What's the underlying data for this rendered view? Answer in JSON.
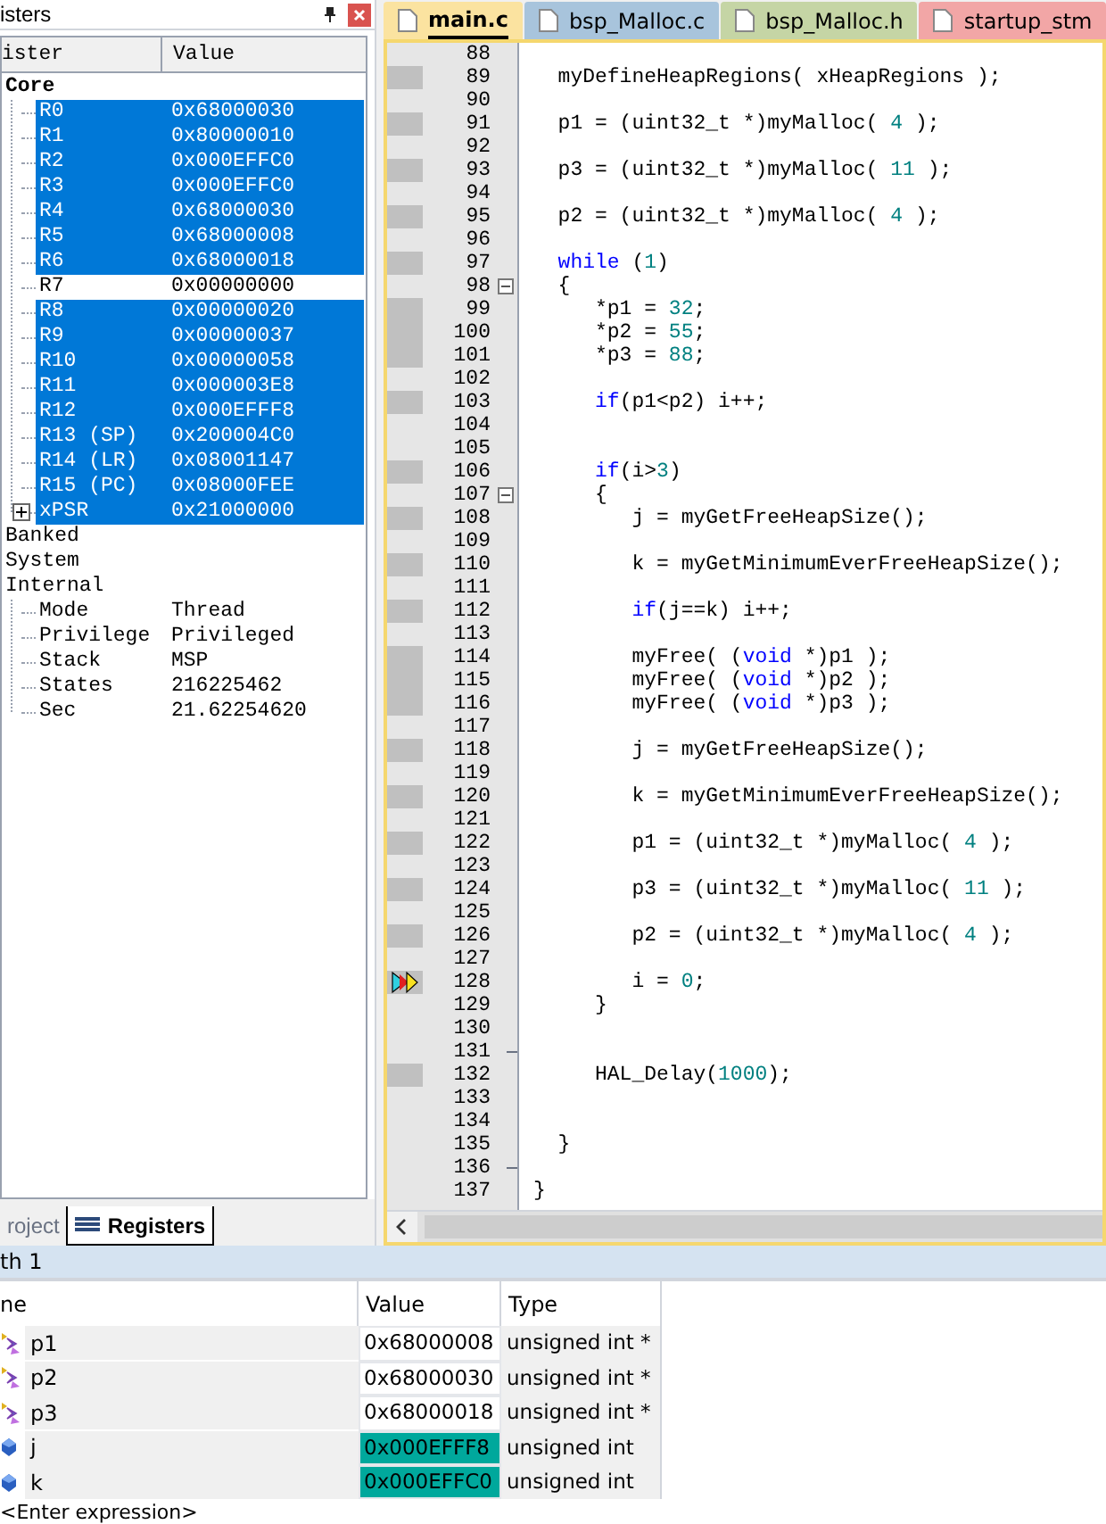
{
  "registers_panel": {
    "title": "isters",
    "columns": [
      "ister",
      "Value"
    ],
    "tree": [
      {
        "name": "Core",
        "children": [
          {
            "name": "R0",
            "value": "0x68000030",
            "selected": true,
            "kind": "register"
          },
          {
            "name": "R1",
            "value": "0x80000010",
            "selected": true,
            "kind": "register"
          },
          {
            "name": "R2",
            "value": "0x000EFFC0",
            "selected": true,
            "kind": "register"
          },
          {
            "name": "R3",
            "value": "0x000EFFC0",
            "selected": true,
            "kind": "register"
          },
          {
            "name": "R4",
            "value": "0x68000030",
            "selected": true,
            "kind": "register"
          },
          {
            "name": "R5",
            "value": "0x68000008",
            "selected": true,
            "kind": "register"
          },
          {
            "name": "R6",
            "value": "0x68000018",
            "selected": true,
            "kind": "register"
          },
          {
            "name": "R7",
            "value": "0x00000000",
            "selected": false,
            "kind": "register"
          },
          {
            "name": "R8",
            "value": "0x00000020",
            "selected": true,
            "kind": "register"
          },
          {
            "name": "R9",
            "value": "0x00000037",
            "selected": true,
            "kind": "register"
          },
          {
            "name": "R10",
            "value": "0x00000058",
            "selected": true,
            "kind": "register"
          },
          {
            "name": "R11",
            "value": "0x000003E8",
            "selected": true,
            "kind": "register"
          },
          {
            "name": "R12",
            "value": "0x000EFFF8",
            "selected": true,
            "kind": "register"
          },
          {
            "name": "R13 (SP)",
            "value": "0x200004C0",
            "selected": true,
            "kind": "register"
          },
          {
            "name": "R14 (LR)",
            "value": "0x08001147",
            "selected": true,
            "kind": "register"
          },
          {
            "name": "R15 (PC)",
            "value": "0x08000FEE",
            "selected": true,
            "kind": "register"
          },
          {
            "name": "xPSR",
            "value": "0x21000000",
            "selected": true,
            "kind": "group"
          }
        ]
      },
      {
        "name": "Banked"
      },
      {
        "name": "System"
      },
      {
        "name": "Internal",
        "children": [
          {
            "name": "Mode",
            "value": "Thread",
            "selected": false,
            "kind": "register"
          },
          {
            "name": "Privilege",
            "value": "Privileged",
            "selected": false,
            "kind": "register"
          },
          {
            "name": "Stack",
            "value": "MSP",
            "selected": false,
            "kind": "register"
          },
          {
            "name": "States",
            "value": "216225462",
            "selected": false,
            "kind": "register"
          },
          {
            "name": "Sec",
            "value": "21.62254620",
            "selected": false,
            "kind": "register"
          }
        ]
      }
    ],
    "bottom_tabs": [
      {
        "label": "roject",
        "selected": false
      },
      {
        "label": "Registers",
        "selected": true
      }
    ]
  },
  "editor": {
    "tabs": [
      {
        "label": "main.c",
        "selected": true,
        "color": "#fbe3a0"
      },
      {
        "label": "bsp_Malloc.c",
        "selected": false,
        "color": "#a8c4dc"
      },
      {
        "label": "bsp_Malloc.h",
        "selected": false,
        "color": "#c5d5a5"
      },
      {
        "label": "startup_stm",
        "selected": false,
        "color": "#f2a6a6"
      }
    ],
    "lines": [
      {
        "number": "88",
        "kind": "plain",
        "executable": false,
        "current": false
      },
      {
        "number": "89",
        "kind": "plain",
        "executable": true,
        "current": false,
        "code": [
          {
            "kind": "plain",
            "text": "  myDefineHeapRegions( xHeapRegions );"
          }
        ]
      },
      {
        "number": "90",
        "kind": "plain",
        "executable": false,
        "current": false
      },
      {
        "number": "91",
        "kind": "plain",
        "executable": true,
        "current": false,
        "code": [
          {
            "kind": "plain",
            "text": "  p1 = (uint32_t *)myMalloc( "
          },
          {
            "kind": "number",
            "text": "4"
          },
          {
            "kind": "plain",
            "text": " );"
          }
        ]
      },
      {
        "number": "92",
        "kind": "plain",
        "executable": false,
        "current": false
      },
      {
        "number": "93",
        "kind": "plain",
        "executable": true,
        "current": false,
        "code": [
          {
            "kind": "plain",
            "text": "  p3 = (uint32_t *)myMalloc( "
          },
          {
            "kind": "number",
            "text": "11"
          },
          {
            "kind": "plain",
            "text": " );"
          }
        ]
      },
      {
        "number": "94",
        "kind": "plain",
        "executable": false,
        "current": false
      },
      {
        "number": "95",
        "kind": "plain",
        "executable": true,
        "current": false,
        "code": [
          {
            "kind": "plain",
            "text": "  p2 = (uint32_t *)myMalloc( "
          },
          {
            "kind": "number",
            "text": "4"
          },
          {
            "kind": "plain",
            "text": " );"
          }
        ]
      },
      {
        "number": "96",
        "kind": "plain",
        "executable": false,
        "current": false
      },
      {
        "number": "97",
        "kind": "plain",
        "executable": true,
        "current": false,
        "code": [
          {
            "kind": "keyword",
            "text": "  while"
          },
          {
            "kind": "plain",
            "text": " ("
          },
          {
            "kind": "number",
            "text": "1"
          },
          {
            "kind": "plain",
            "text": ")"
          }
        ]
      },
      {
        "number": "98",
        "kind": "fold_start",
        "executable": false,
        "current": false,
        "code": [
          {
            "kind": "plain",
            "text": "  {"
          }
        ]
      },
      {
        "number": "99",
        "kind": "plain",
        "executable": true,
        "current": false,
        "code": [
          {
            "kind": "plain",
            "text": "     *p1 = "
          },
          {
            "kind": "number",
            "text": "32"
          },
          {
            "kind": "plain",
            "text": ";"
          }
        ]
      },
      {
        "number": "100",
        "kind": "plain",
        "executable": true,
        "current": false,
        "code": [
          {
            "kind": "plain",
            "text": "     *p2 = "
          },
          {
            "kind": "number",
            "text": "55"
          },
          {
            "kind": "plain",
            "text": ";"
          }
        ]
      },
      {
        "number": "101",
        "kind": "plain",
        "executable": true,
        "current": false,
        "code": [
          {
            "kind": "plain",
            "text": "     *p3 = "
          },
          {
            "kind": "number",
            "text": "88"
          },
          {
            "kind": "plain",
            "text": ";"
          }
        ]
      },
      {
        "number": "102",
        "kind": "plain",
        "executable": false,
        "current": false
      },
      {
        "number": "103",
        "kind": "plain",
        "executable": true,
        "current": false,
        "code": [
          {
            "kind": "keyword",
            "text": "     if"
          },
          {
            "kind": "plain",
            "text": "(p1<p2) i++;"
          }
        ]
      },
      {
        "number": "104",
        "kind": "plain",
        "executable": false,
        "current": false
      },
      {
        "number": "105",
        "kind": "plain",
        "executable": false,
        "current": false
      },
      {
        "number": "106",
        "kind": "plain",
        "executable": true,
        "current": false,
        "code": [
          {
            "kind": "keyword",
            "text": "     if"
          },
          {
            "kind": "plain",
            "text": "(i>"
          },
          {
            "kind": "number",
            "text": "3"
          },
          {
            "kind": "plain",
            "text": ")"
          }
        ]
      },
      {
        "number": "107",
        "kind": "fold_start",
        "executable": false,
        "current": false,
        "code": [
          {
            "kind": "plain",
            "text": "     {"
          }
        ]
      },
      {
        "number": "108",
        "kind": "plain",
        "executable": true,
        "current": false,
        "code": [
          {
            "kind": "plain",
            "text": "        j = myGetFreeHeapSize();"
          }
        ]
      },
      {
        "number": "109",
        "kind": "plain",
        "executable": false,
        "current": false
      },
      {
        "number": "110",
        "kind": "plain",
        "executable": true,
        "current": false,
        "code": [
          {
            "kind": "plain",
            "text": "        k = myGetMinimumEverFreeHeapSize();"
          }
        ]
      },
      {
        "number": "111",
        "kind": "plain",
        "executable": false,
        "current": false
      },
      {
        "number": "112",
        "kind": "plain",
        "executable": true,
        "current": false,
        "code": [
          {
            "kind": "keyword",
            "text": "        if"
          },
          {
            "kind": "plain",
            "text": "(j==k) i++;"
          }
        ]
      },
      {
        "number": "113",
        "kind": "plain",
        "executable": false,
        "current": false
      },
      {
        "number": "114",
        "kind": "plain",
        "executable": true,
        "current": false,
        "code": [
          {
            "kind": "plain",
            "text": "        myFree( ("
          },
          {
            "kind": "keyword",
            "text": "void"
          },
          {
            "kind": "plain",
            "text": " *)p1 );"
          }
        ]
      },
      {
        "number": "115",
        "kind": "plain",
        "executable": true,
        "current": false,
        "code": [
          {
            "kind": "plain",
            "text": "        myFree( ("
          },
          {
            "kind": "keyword",
            "text": "void"
          },
          {
            "kind": "plain",
            "text": " *)p2 );"
          }
        ]
      },
      {
        "number": "116",
        "kind": "plain",
        "executable": true,
        "current": false,
        "code": [
          {
            "kind": "plain",
            "text": "        myFree( ("
          },
          {
            "kind": "keyword",
            "text": "void"
          },
          {
            "kind": "plain",
            "text": " *)p3 );"
          }
        ]
      },
      {
        "number": "117",
        "kind": "plain",
        "executable": false,
        "current": false
      },
      {
        "number": "118",
        "kind": "plain",
        "executable": true,
        "current": false,
        "code": [
          {
            "kind": "plain",
            "text": "        j = myGetFreeHeapSize();"
          }
        ]
      },
      {
        "number": "119",
        "kind": "plain",
        "executable": false,
        "current": false
      },
      {
        "number": "120",
        "kind": "plain",
        "executable": true,
        "current": false,
        "code": [
          {
            "kind": "plain",
            "text": "        k = myGetMinimumEverFreeHeapSize();"
          }
        ]
      },
      {
        "number": "121",
        "kind": "plain",
        "executable": false,
        "current": false
      },
      {
        "number": "122",
        "kind": "plain",
        "executable": true,
        "current": false,
        "code": [
          {
            "kind": "plain",
            "text": "        p1 = (uint32_t *)myMalloc( "
          },
          {
            "kind": "number",
            "text": "4"
          },
          {
            "kind": "plain",
            "text": " );"
          }
        ]
      },
      {
        "number": "123",
        "kind": "plain",
        "executable": false,
        "current": false
      },
      {
        "number": "124",
        "kind": "plain",
        "executable": true,
        "current": false,
        "code": [
          {
            "kind": "plain",
            "text": "        p3 = (uint32_t *)myMalloc( "
          },
          {
            "kind": "number",
            "text": "11"
          },
          {
            "kind": "plain",
            "text": " );"
          }
        ]
      },
      {
        "number": "125",
        "kind": "plain",
        "executable": false,
        "current": false
      },
      {
        "number": "126",
        "kind": "plain",
        "executable": true,
        "current": false,
        "code": [
          {
            "kind": "plain",
            "text": "        p2 = (uint32_t *)myMalloc( "
          },
          {
            "kind": "number",
            "text": "4"
          },
          {
            "kind": "plain",
            "text": " );"
          }
        ]
      },
      {
        "number": "127",
        "kind": "plain",
        "executable": false,
        "current": false
      },
      {
        "number": "128",
        "kind": "plain",
        "executable": true,
        "current": true,
        "code": [
          {
            "kind": "plain",
            "text": "        i = "
          },
          {
            "kind": "number",
            "text": "0"
          },
          {
            "kind": "plain",
            "text": ";"
          }
        ]
      },
      {
        "number": "129",
        "kind": "plain",
        "executable": false,
        "current": false,
        "code": [
          {
            "kind": "plain",
            "text": "     }"
          }
        ]
      },
      {
        "number": "130",
        "kind": "plain",
        "executable": false,
        "current": false
      },
      {
        "number": "131",
        "kind": "fold_end",
        "executable": false,
        "current": false
      },
      {
        "number": "132",
        "kind": "plain",
        "executable": true,
        "current": false,
        "code": [
          {
            "kind": "plain",
            "text": "     HAL_Delay("
          },
          {
            "kind": "number",
            "text": "1000"
          },
          {
            "kind": "plain",
            "text": ");"
          }
        ]
      },
      {
        "number": "133",
        "kind": "plain",
        "executable": false,
        "current": false
      },
      {
        "number": "134",
        "kind": "plain",
        "executable": false,
        "current": false
      },
      {
        "number": "135",
        "kind": "plain",
        "executable": false,
        "current": false,
        "code": [
          {
            "kind": "plain",
            "text": "  }"
          }
        ]
      },
      {
        "number": "136",
        "kind": "fold_end",
        "executable": false,
        "current": false
      },
      {
        "number": "137",
        "kind": "plain",
        "executable": false,
        "current": false,
        "code": [
          {
            "kind": "plain",
            "text": "}"
          }
        ]
      }
    ]
  },
  "watch_panel": {
    "title": "th 1",
    "columns": [
      "ne",
      "Value",
      "Type"
    ],
    "rows": [
      {
        "name": "p1",
        "value": "0x68000008",
        "type": "unsigned int *",
        "kind": "pointer",
        "changed": false
      },
      {
        "name": "p2",
        "value": "0x68000030",
        "type": "unsigned int *",
        "kind": "pointer",
        "changed": false
      },
      {
        "name": "p3",
        "value": "0x68000018",
        "type": "unsigned int *",
        "kind": "pointer",
        "changed": false
      },
      {
        "name": "j",
        "value": "0x000EFFF8",
        "type": "unsigned int",
        "kind": "variable",
        "changed": true
      },
      {
        "name": "k",
        "value": "0x000EFFC0",
        "type": "unsigned int",
        "kind": "variable",
        "changed": true
      }
    ],
    "enter_expression": "<Enter expression>"
  }
}
